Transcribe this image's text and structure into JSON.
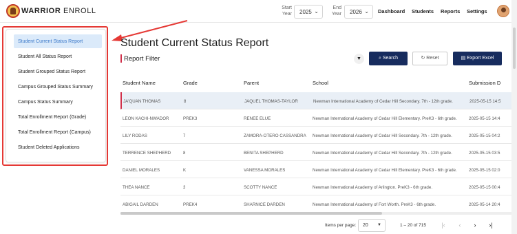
{
  "header": {
    "brand_bold": "WARRIOR",
    "brand_light": "ENROLL",
    "start_year_label_1": "Start",
    "start_year_label_2": "Year",
    "start_year_value": "2025",
    "end_year_label_1": "End",
    "end_year_label_2": "Year",
    "end_year_value": "2026",
    "nav": [
      "Dashboard",
      "Students",
      "Reports",
      "Settings"
    ]
  },
  "sidebar": {
    "items": [
      "Student Current Status Report",
      "Student All Status Report",
      "Student Grouped Status Report",
      "Campus Grouped Status Summary",
      "Campus Status Summary",
      "Total Enrollment Report (Grade)",
      "Total Enrollment Report (Campus)",
      "Student Deleted Applications"
    ],
    "active_index": 0
  },
  "main": {
    "title": "Student Current Status Report",
    "filter_title": "Report Filter",
    "search_label": "Search",
    "reset_label": "Reset",
    "export_label": "Export Excel"
  },
  "table": {
    "columns": [
      "Student Name",
      "Grade",
      "Parent",
      "School",
      "Submission D"
    ],
    "rows": [
      [
        "JA'QUAN THOMAS",
        "8",
        "JAQUEL THOMAS-TAYLOR",
        "Newman International Academy of Cedar Hill Secondary. 7th - 12th grade.",
        "2025-05-15 14:5"
      ],
      [
        "LEON KACHI-NWADOR",
        "PREK3",
        "RENEE ELUE",
        "Newman International Academy of Cedar Hill Elementary. PreK3 - 6th grade.",
        "2025-05-15 14:4"
      ],
      [
        "LILY RODAS",
        "7",
        "ZAMORA-OTERO CASSANDRA",
        "Newman International Academy of Cedar Hill Secondary. 7th - 12th grade.",
        "2025-05-15 04:2"
      ],
      [
        "TERRENCE SHEPHERD",
        "8",
        "BENITA SHEPHERD",
        "Newman International Academy of Cedar Hill Secondary. 7th - 12th grade.",
        "2025-05-15 03:5"
      ],
      [
        "DANIEL MORALES",
        "K",
        "VANESSA MORALES",
        "Newman International Academy of Cedar Hill Elementary. PreK3 - 6th grade.",
        "2025-05-15 02:0"
      ],
      [
        "THEA NANCE",
        "3",
        "SCOTTY NANCE",
        "Newman International Academy of Arlington. PreK3 - 6th grade.",
        "2025-05-15 00:4"
      ],
      [
        "ABIGAIL DARDEN",
        "PREK4",
        "SHARNICE DARDEN",
        "Newman International Academy of Fort Worth. PreK3 - 6th grade.",
        "2025-05-14 20:4"
      ]
    ],
    "selected_row": 0
  },
  "pagination": {
    "items_per_page_label": "Items per page:",
    "items_per_page_value": "20",
    "range": "1 – 20 of 715"
  },
  "colors": {
    "primary": "#172c5e",
    "accent_red": "#d0304a",
    "active_bg": "#dbeafa",
    "annotation_red": "#e53935"
  }
}
